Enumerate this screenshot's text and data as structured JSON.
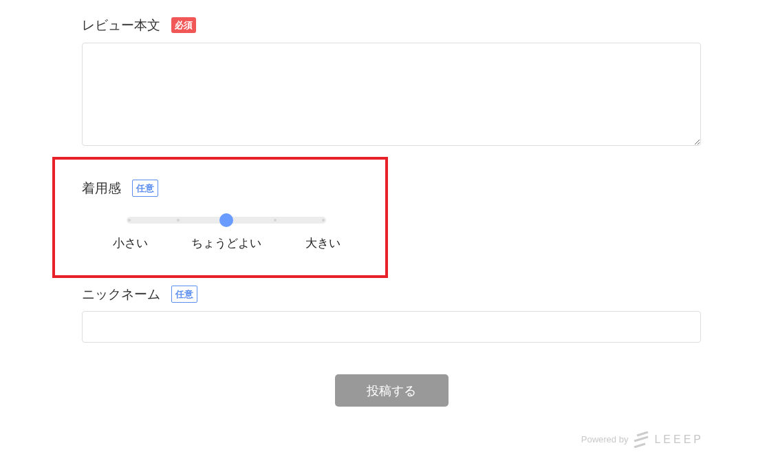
{
  "fields": [
    {
      "kind": "textarea",
      "label": "レビュー本文",
      "badge": {
        "kind": "required",
        "text": "必須"
      },
      "highlighted": false
    },
    {
      "kind": "slider",
      "label": "着用感",
      "badge": {
        "kind": "optional",
        "text": "任意"
      },
      "highlighted": true,
      "level": 0.5,
      "scale_labels": [
        "小さい",
        "ちょうどよい",
        "大きい"
      ]
    },
    {
      "kind": "text",
      "label": "ニックネーム",
      "badge": {
        "kind": "optional",
        "text": "任意"
      },
      "highlighted": false
    }
  ],
  "submit_button": {
    "label": "投稿する",
    "disabled": true
  },
  "footer": {
    "powered_by": "Powered by",
    "brand": "LEEEP"
  }
}
